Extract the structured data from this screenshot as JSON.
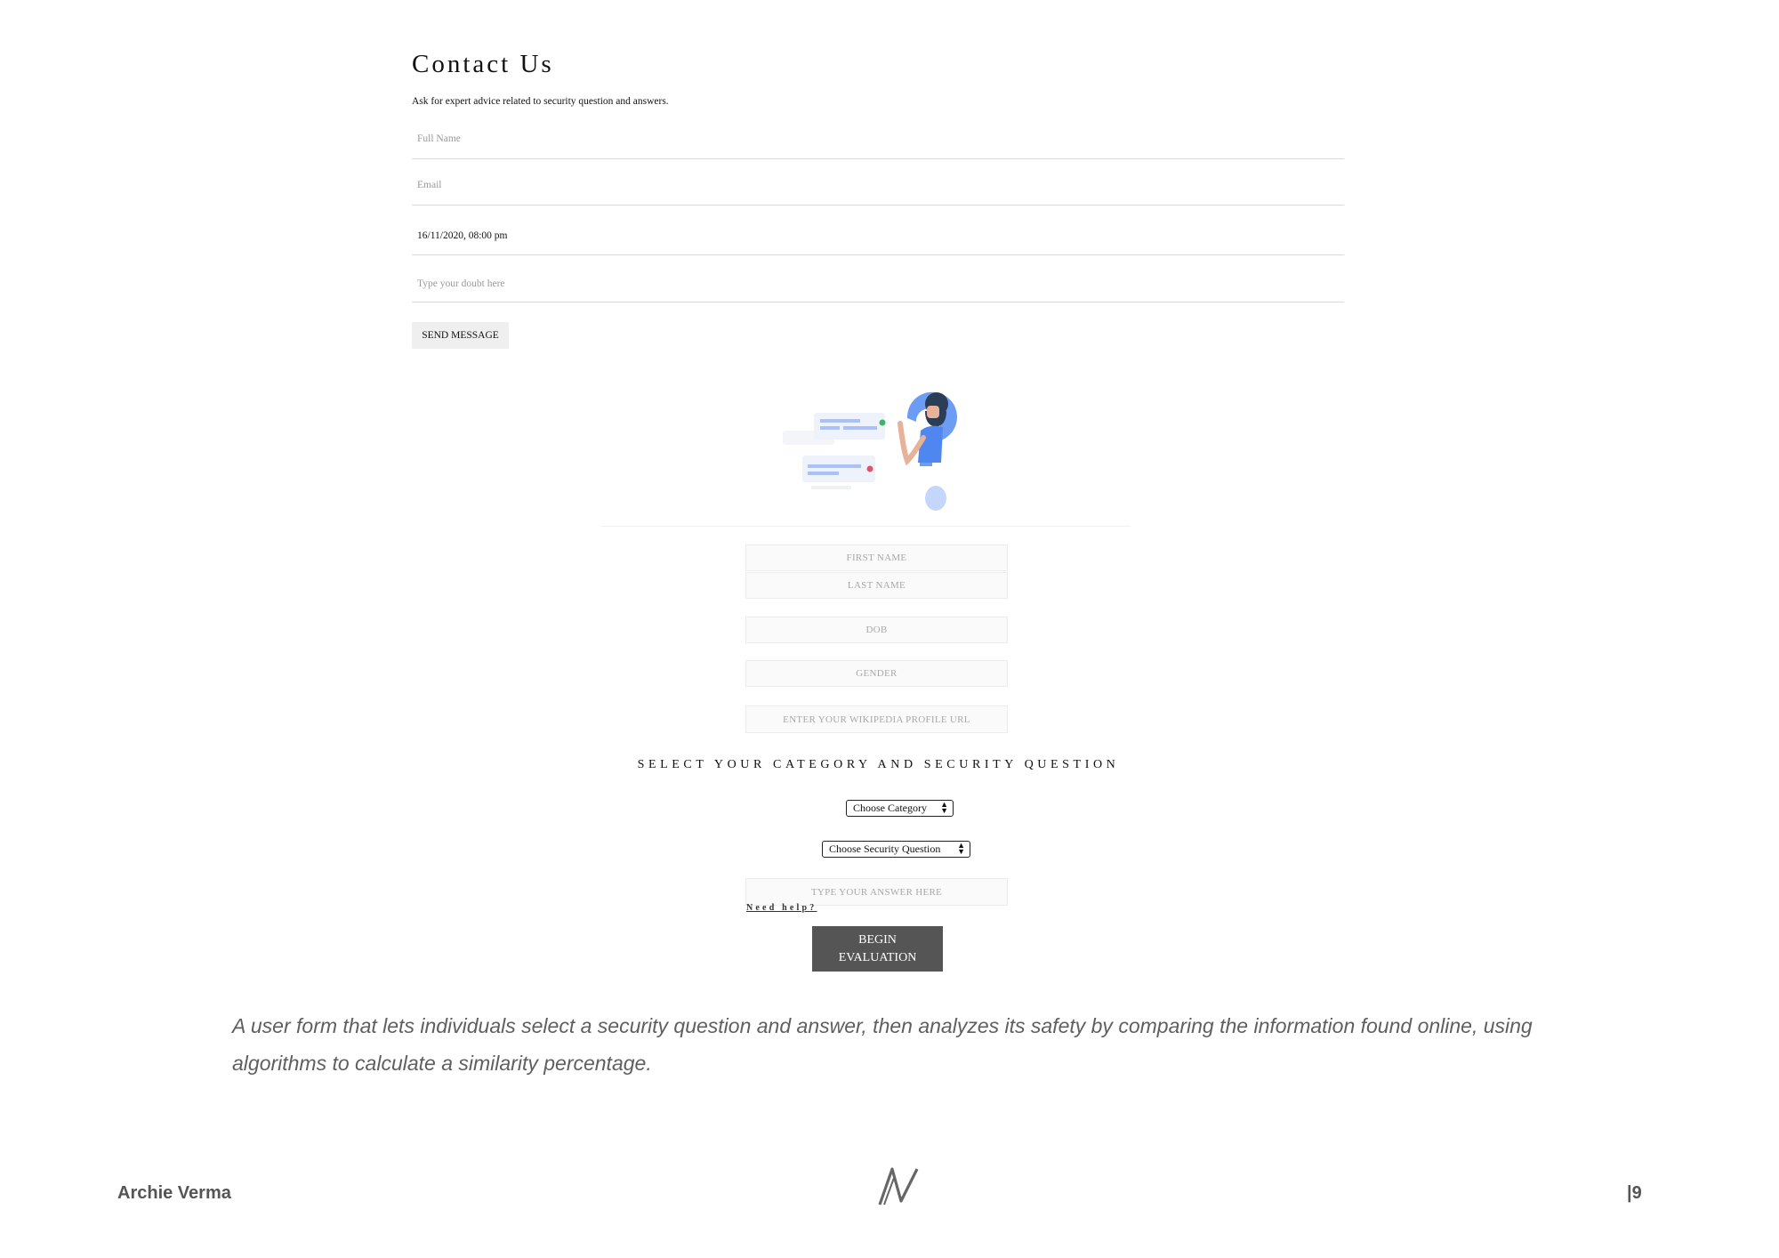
{
  "contact": {
    "title": "Contact Us",
    "subtitle": "Ask for expert advice related to security question and answers.",
    "full_name_placeholder": "Full Name",
    "email_placeholder": "Email",
    "datetime_value": "16/11/2020, 08:00 pm",
    "doubt_placeholder": "Type your doubt here",
    "send_label": "SEND MESSAGE"
  },
  "evaluation": {
    "first_name_placeholder": "FIRST NAME",
    "last_name_placeholder": "LAST NAME",
    "dob_placeholder": "DOB",
    "gender_placeholder": "GENDER",
    "wiki_placeholder": "ENTER YOUR WIKIPEDIA PROFILE URL",
    "category_heading": "SELECT YOUR CATEGORY AND SECURITY QUESTION",
    "category_select": "Choose Category",
    "question_select": "Choose Security Question",
    "answer_placeholder": "TYPE YOUR ANSWER HERE",
    "need_help": "Need help?",
    "begin_label": "BEGIN\nEVALUATION"
  },
  "caption": "A user form that lets individuals select a security question and answer, then analyzes its safety by comparing the information found online, using algorithms to calculate a similarity percentage.",
  "footer": {
    "author": "Archie Verma",
    "page": "|9"
  },
  "icons": {
    "illustration": "person-with-question-mark-illustration",
    "logo": "nv-monogram-logo"
  },
  "colors": {
    "begin_button": "#555555",
    "send_button": "#efefef",
    "caption_text": "#5f5f5f",
    "illustration_accent": "#6d9cf5"
  }
}
